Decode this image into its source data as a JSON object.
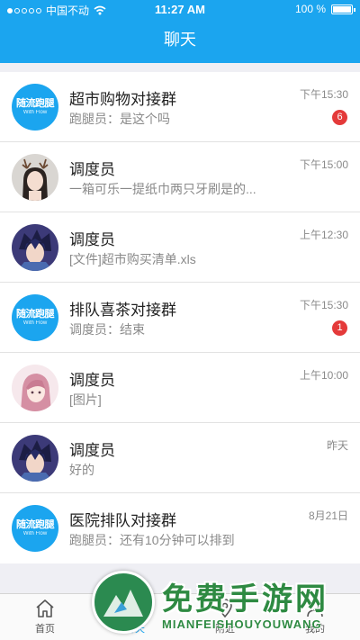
{
  "status_bar": {
    "carrier": "中国不动",
    "time": "11:27 AM",
    "battery": "100 %"
  },
  "header": {
    "title": "聊天"
  },
  "chats": [
    {
      "avatar": "brand-logo",
      "name": "超市购物对接群",
      "preview": "跑腿员：是这个吗",
      "time": "下午15:30",
      "badge": "6"
    },
    {
      "avatar": "girl-antlers",
      "name": "调度员",
      "preview": "一箱可乐一提纸巾两只牙刷是的...",
      "time": "下午15:00",
      "badge": ""
    },
    {
      "avatar": "anime-boy",
      "name": "调度员",
      "preview": "[文件]超市购买清单.xls",
      "time": "上午12:30",
      "badge": ""
    },
    {
      "avatar": "brand-logo",
      "name": "排队喜茶对接群",
      "preview": "调度员：结束",
      "time": "下午15:30",
      "badge": "1"
    },
    {
      "avatar": "anime-girl",
      "name": "调度员",
      "preview": "[图片]",
      "time": "上午10:00",
      "badge": ""
    },
    {
      "avatar": "anime-boy",
      "name": "调度员",
      "preview": "好的",
      "time": "昨天",
      "badge": ""
    },
    {
      "avatar": "brand-logo",
      "name": "医院排队对接群",
      "preview": "跑腿员：还有10分钟可以排到",
      "time": "8月21日",
      "badge": ""
    }
  ],
  "brand": {
    "main": "随流跑腿",
    "sub": "With Flow"
  },
  "tabs": [
    {
      "label": "首页",
      "icon": "home-icon"
    },
    {
      "label": "聊天",
      "icon": "chat-icon",
      "active": true
    },
    {
      "label": "附近",
      "icon": "location-icon"
    },
    {
      "label": "我的",
      "icon": "profile-icon"
    }
  ],
  "watermark": {
    "title": "免费手游网",
    "subtitle": "MIANFEISHOUYOUWANG"
  },
  "colors": {
    "accent": "#1ba5ef",
    "badge": "#e43a3a",
    "watermark": "#2e8a42"
  }
}
